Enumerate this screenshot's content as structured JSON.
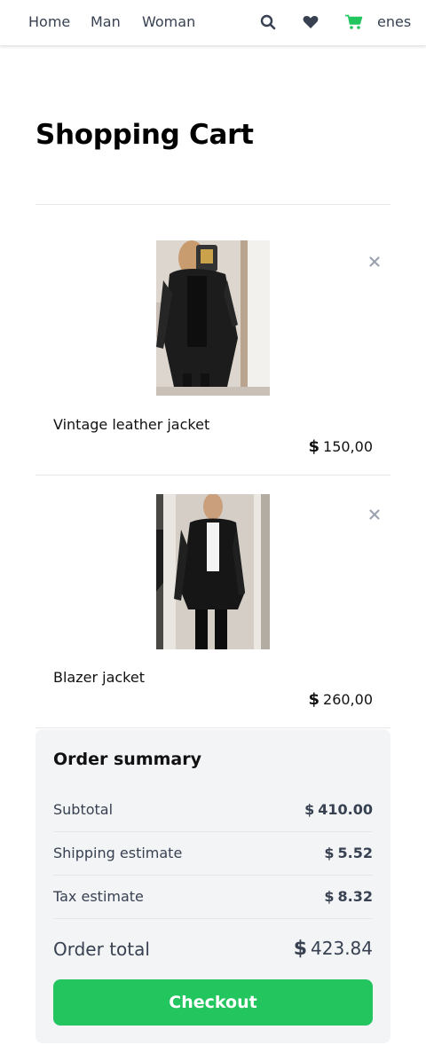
{
  "nav": {
    "links": [
      "Home",
      "Man",
      "Woman"
    ],
    "user": "enes",
    "icons": [
      "search-icon",
      "heart-icon",
      "cart-icon"
    ],
    "cart_icon_color": "#22c55e",
    "icon_color": "#374151"
  },
  "page": {
    "title": "Shopping Cart"
  },
  "cart": {
    "currency_symbol": "$",
    "items": [
      {
        "name": "Vintage leather jacket",
        "price": "150,00"
      },
      {
        "name": "Blazer jacket",
        "price": "260,00"
      }
    ]
  },
  "summary": {
    "title": "Order summary",
    "currency_symbol": "$",
    "rows": [
      {
        "label": "Subtotal",
        "value": "410.00"
      },
      {
        "label": "Shipping estimate",
        "value": "5.52"
      },
      {
        "label": "Tax estimate",
        "value": "8.32"
      }
    ],
    "total_label": "Order total",
    "total_value": "423.84",
    "checkout_label": "Checkout",
    "checkout_color": "#22c55e"
  }
}
